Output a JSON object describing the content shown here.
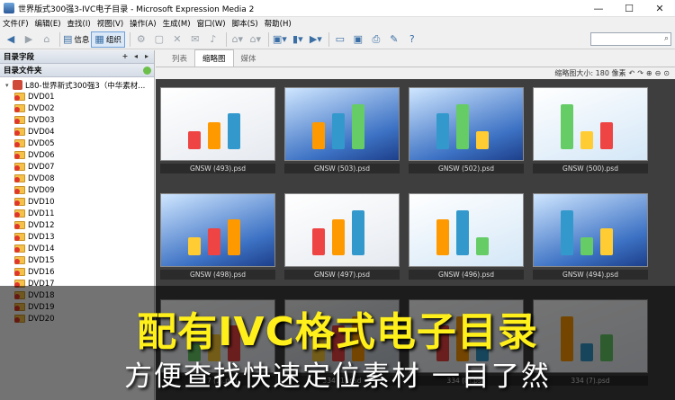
{
  "window": {
    "title": "世界版式300强3-IVC电子目录 - Microsoft Expression Media 2",
    "minimize": "—",
    "maximize": "☐",
    "close": "✕"
  },
  "menu": [
    "文件(F)",
    "编辑(E)",
    "查找(I)",
    "视图(V)",
    "操作(A)",
    "生成(M)",
    "窗口(W)",
    "脚本(S)",
    "帮助(H)"
  ],
  "toolbar": {
    "info_label": "信息",
    "organize_label": "组织",
    "search_placeholder": ""
  },
  "left_panel": {
    "header1": "目录字段",
    "header2": "目录文件夹",
    "root": "L80-世界新式300强3（中华素材...",
    "folders": [
      "DVD01",
      "DVD02",
      "DVD03",
      "DVD04",
      "DVD05",
      "DVD06",
      "DVD07",
      "DVD08",
      "DVD09",
      "DVD10",
      "DVD11",
      "DVD12",
      "DVD13",
      "DVD14",
      "DVD15",
      "DVD16",
      "DVD17",
      "DVD18",
      "DVD19",
      "DVD20"
    ]
  },
  "tabs": [
    "列表",
    "缩略图",
    "媒体"
  ],
  "thumb_bar": {
    "size_text": "缩略图大小: 180 像素"
  },
  "thumbnails": [
    {
      "label": "GNSW (493).psd"
    },
    {
      "label": "GNSW (503).psd"
    },
    {
      "label": "GNSW (502).psd"
    },
    {
      "label": "GNSW (500).psd"
    },
    {
      "label": "GNSW (498).psd"
    },
    {
      "label": "GNSW (497).psd"
    },
    {
      "label": "GNSW (496).psd"
    },
    {
      "label": "GNSW (494).psd"
    },
    {
      "label": "327 (1).psd"
    },
    {
      "label": "334 (1).psd"
    },
    {
      "label": "334 (8).psd"
    },
    {
      "label": "334 (7).psd"
    }
  ],
  "overlay": {
    "line1": "配有IVC格式电子目录",
    "line2": "方便查找快速定位素材 一目了然"
  }
}
